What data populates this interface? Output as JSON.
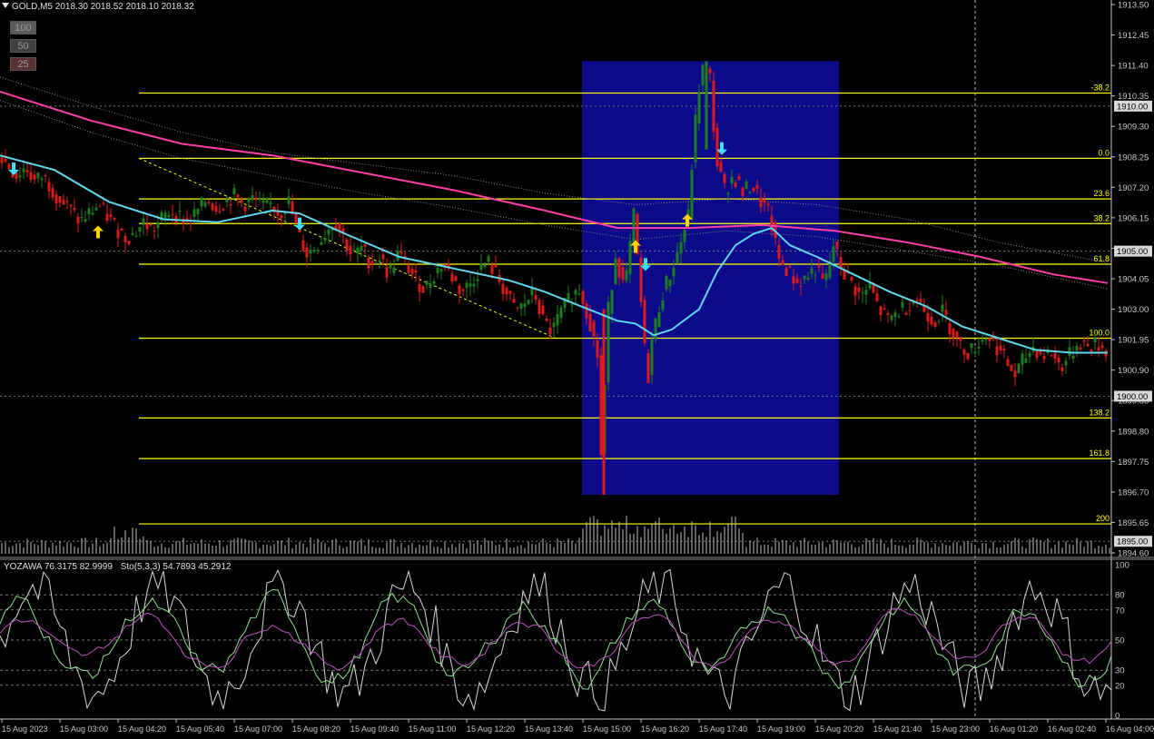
{
  "header": {
    "title": "GOLD,M5  2018.30 2018.52 2018.10 2018.32"
  },
  "buttons": [
    {
      "label": "100",
      "bg": "#5a5a5a"
    },
    {
      "label": "50",
      "bg": "#404040"
    },
    {
      "label": "25",
      "bg": "#5a3030"
    }
  ],
  "indicator_header": {
    "yozawa": "YOZAWA 76.3175 82.9999",
    "sto": "Sto(5,3,3) 54.7893 45.2912"
  },
  "colors": {
    "background": "#000000",
    "axis_text": "#c8c8c8",
    "grid": "#6e6e6e",
    "bull": "#1f7d1f",
    "bear": "#dd1a1a",
    "fib": "#ffff00",
    "ma_fast": "#5fd7f0",
    "ma_slow": "#ff3fa5",
    "highlight_box": "#0a0a8a",
    "volume": "#bfbfbf",
    "arrow_up": "#ffd400",
    "arrow_down": "#3fe0ff",
    "osc_white": "#d8d8d8",
    "osc_green": "#8fe08f",
    "osc_magenta": "#c050c0"
  },
  "chart_data": [
    {
      "type": "candlestick",
      "symbol": "GOLD",
      "timeframe": "M5",
      "price_axis": {
        "ylim": [
          1894.6,
          1913.5
        ],
        "ticks": [
          "1913.50",
          "1912.45",
          "1911.40",
          "1910.35",
          "1909.30",
          "1908.25",
          "1907.20",
          "1906.15",
          "1905.10",
          "1904.05",
          "1903.00",
          "1901.95",
          "1900.90",
          "1899.85",
          "1898.80",
          "1897.75",
          "1896.70",
          "1895.65",
          "1894.60"
        ],
        "markers": [
          {
            "label": "1910.00",
            "value": 1910.0
          },
          {
            "label": "1905.00",
            "value": 1905.0
          },
          {
            "label": "1900.00",
            "value": 1900.0
          },
          {
            "label": "1895.00",
            "value": 1895.0
          }
        ]
      },
      "time_axis": {
        "labels": [
          "15 Aug 2023",
          "15 Aug 03:00",
          "15 Aug 04:20",
          "15 Aug 05:40",
          "15 Aug 07:00",
          "15 Aug 08:20",
          "15 Aug 09:40",
          "15 Aug 11:00",
          "15 Aug 12:20",
          "15 Aug 13:40",
          "15 Aug 15:00",
          "15 Aug 16:20",
          "15 Aug 17:40",
          "15 Aug 19:00",
          "15 Aug 20:20",
          "15 Aug 21:40",
          "15 Aug 23:00",
          "16 Aug 01:20",
          "16 Aug 02:40",
          "16 Aug 04:00"
        ]
      },
      "fib_levels": [
        {
          "label": "-38.2",
          "price": 1910.45
        },
        {
          "label": "0.0",
          "price": 1908.2
        },
        {
          "label": "23.6",
          "price": 1906.8
        },
        {
          "label": "38.2",
          "price": 1905.95
        },
        {
          "label": "61.8",
          "price": 1904.55
        },
        {
          "label": "100.0",
          "price": 1902.0
        },
        {
          "label": "138.2",
          "price": 1899.25
        },
        {
          "label": "161.8",
          "price": 1897.85
        },
        {
          "label": "200",
          "price": 1895.6
        }
      ],
      "price_path": [
        [
          0,
          1908.3
        ],
        [
          10,
          1908.0
        ],
        [
          20,
          1907.6
        ],
        [
          30,
          1907.9
        ],
        [
          40,
          1907.4
        ],
        [
          50,
          1907.6
        ],
        [
          60,
          1907.1
        ],
        [
          70,
          1906.7
        ],
        [
          80,
          1906.4
        ],
        [
          90,
          1906.0
        ],
        [
          100,
          1906.3
        ],
        [
          110,
          1906.6
        ],
        [
          120,
          1906.2
        ],
        [
          130,
          1905.8
        ],
        [
          140,
          1905.5
        ],
        [
          150,
          1905.6
        ],
        [
          160,
          1906.0
        ],
        [
          170,
          1905.7
        ],
        [
          180,
          1906.1
        ],
        [
          190,
          1906.4
        ],
        [
          200,
          1906.2
        ],
        [
          210,
          1906.0
        ],
        [
          220,
          1906.4
        ],
        [
          230,
          1906.8
        ],
        [
          240,
          1906.5
        ],
        [
          250,
          1906.7
        ],
        [
          260,
          1906.9
        ],
        [
          270,
          1906.6
        ],
        [
          280,
          1906.8
        ],
        [
          290,
          1906.5
        ],
        [
          300,
          1906.6
        ],
        [
          310,
          1906.3
        ],
        [
          320,
          1906.7
        ],
        [
          330,
          1905.6
        ],
        [
          340,
          1904.9
        ],
        [
          350,
          1905.2
        ],
        [
          360,
          1905.6
        ],
        [
          370,
          1906.1
        ],
        [
          380,
          1905.5
        ],
        [
          390,
          1904.8
        ],
        [
          400,
          1905.1
        ],
        [
          410,
          1904.6
        ],
        [
          420,
          1904.8
        ],
        [
          430,
          1904.2
        ],
        [
          440,
          1904.9
        ],
        [
          450,
          1904.5
        ],
        [
          460,
          1904.0
        ],
        [
          470,
          1903.7
        ],
        [
          480,
          1904.2
        ],
        [
          490,
          1904.6
        ],
        [
          500,
          1904.1
        ],
        [
          510,
          1903.6
        ],
        [
          520,
          1903.9
        ],
        [
          530,
          1904.4
        ],
        [
          540,
          1904.6
        ],
        [
          550,
          1904.1
        ],
        [
          560,
          1903.5
        ],
        [
          570,
          1902.9
        ],
        [
          580,
          1903.2
        ],
        [
          590,
          1903.6
        ],
        [
          600,
          1902.6
        ],
        [
          610,
          1902.2
        ],
        [
          620,
          1902.9
        ],
        [
          630,
          1903.4
        ],
        [
          640,
          1903.7
        ],
        [
          650,
          1902.8
        ],
        [
          660,
          1901.4
        ],
        [
          665,
          1897.1
        ],
        [
          670,
          1902.5
        ],
        [
          680,
          1904.9
        ],
        [
          690,
          1903.6
        ],
        [
          700,
          1906.2
        ],
        [
          705,
          1904.4
        ],
        [
          715,
          1900.4
        ],
        [
          720,
          1901.9
        ],
        [
          730,
          1903.4
        ],
        [
          740,
          1904.2
        ],
        [
          750,
          1905.1
        ],
        [
          760,
          1906.2
        ],
        [
          765,
          1908.4
        ],
        [
          770,
          1910.2
        ],
        [
          775,
          1911.3
        ],
        [
          780,
          1911.2
        ],
        [
          785,
          1910.9
        ],
        [
          790,
          1908.2
        ],
        [
          800,
          1907.1
        ],
        [
          810,
          1907.6
        ],
        [
          820,
          1907.0
        ],
        [
          830,
          1907.3
        ],
        [
          840,
          1906.7
        ],
        [
          850,
          1906.2
        ],
        [
          855,
          1905.3
        ],
        [
          860,
          1904.7
        ],
        [
          870,
          1904.3
        ],
        [
          880,
          1903.9
        ],
        [
          890,
          1904.1
        ],
        [
          900,
          1904.4
        ],
        [
          910,
          1903.8
        ],
        [
          920,
          1905.2
        ],
        [
          930,
          1904.3
        ],
        [
          940,
          1903.9
        ],
        [
          950,
          1903.4
        ],
        [
          960,
          1903.8
        ],
        [
          970,
          1903.0
        ],
        [
          980,
          1902.6
        ],
        [
          990,
          1902.9
        ],
        [
          1000,
          1903.1
        ],
        [
          1010,
          1903.4
        ],
        [
          1020,
          1903.0
        ],
        [
          1030,
          1902.6
        ],
        [
          1040,
          1902.9
        ],
        [
          1050,
          1902.3
        ],
        [
          1060,
          1901.7
        ],
        [
          1070,
          1901.5
        ],
        [
          1080,
          1901.9
        ],
        [
          1090,
          1902.1
        ],
        [
          1100,
          1901.7
        ],
        [
          1110,
          1901.2
        ],
        [
          1120,
          1900.7
        ],
        [
          1130,
          1901.3
        ],
        [
          1140,
          1901.7
        ],
        [
          1150,
          1901.4
        ],
        [
          1160,
          1901.5
        ],
        [
          1170,
          1901.0
        ],
        [
          1180,
          1901.4
        ],
        [
          1190,
          1901.9
        ],
        [
          1200,
          1901.7
        ],
        [
          1210,
          1901.8
        ],
        [
          1220,
          1901.6
        ]
      ],
      "ma_fast": [
        [
          0,
          1908.3
        ],
        [
          60,
          1907.8
        ],
        [
          120,
          1906.7
        ],
        [
          180,
          1906.1
        ],
        [
          240,
          1906.0
        ],
        [
          300,
          1906.4
        ],
        [
          330,
          1906.3
        ],
        [
          380,
          1905.6
        ],
        [
          440,
          1904.8
        ],
        [
          500,
          1904.4
        ],
        [
          560,
          1904.0
        ],
        [
          600,
          1903.6
        ],
        [
          640,
          1903.1
        ],
        [
          680,
          1902.6
        ],
        [
          700,
          1902.5
        ],
        [
          720,
          1902.1
        ],
        [
          740,
          1902.3
        ],
        [
          770,
          1903.0
        ],
        [
          790,
          1904.3
        ],
        [
          810,
          1905.2
        ],
        [
          830,
          1905.6
        ],
        [
          850,
          1905.8
        ],
        [
          870,
          1905.2
        ],
        [
          900,
          1904.8
        ],
        [
          940,
          1904.2
        ],
        [
          980,
          1903.6
        ],
        [
          1020,
          1903.1
        ],
        [
          1060,
          1902.4
        ],
        [
          1100,
          1902.0
        ],
        [
          1140,
          1901.6
        ],
        [
          1180,
          1901.5
        ],
        [
          1220,
          1901.5
        ]
      ],
      "ma_slow": [
        [
          0,
          1910.5
        ],
        [
          100,
          1909.5
        ],
        [
          200,
          1908.7
        ],
        [
          300,
          1908.3
        ],
        [
          400,
          1907.7
        ],
        [
          500,
          1907.1
        ],
        [
          600,
          1906.4
        ],
        [
          680,
          1905.8
        ],
        [
          760,
          1905.8
        ],
        [
          840,
          1905.9
        ],
        [
          920,
          1905.7
        ],
        [
          1000,
          1905.3
        ],
        [
          1080,
          1904.8
        ],
        [
          1160,
          1904.2
        ],
        [
          1220,
          1903.9
        ]
      ],
      "ma_dotted_upper": [
        [
          0,
          1911.0
        ],
        [
          100,
          1910.0
        ],
        [
          200,
          1909.1
        ],
        [
          300,
          1908.4
        ],
        [
          400,
          1908.0
        ],
        [
          500,
          1907.6
        ],
        [
          600,
          1907.0
        ],
        [
          700,
          1906.6
        ],
        [
          800,
          1906.8
        ],
        [
          900,
          1906.6
        ],
        [
          1000,
          1906.1
        ],
        [
          1100,
          1905.3
        ],
        [
          1220,
          1904.6
        ]
      ],
      "ma_dotted_lower": [
        [
          0,
          1910.2
        ],
        [
          100,
          1909.1
        ],
        [
          200,
          1908.2
        ],
        [
          300,
          1907.6
        ],
        [
          400,
          1907.0
        ],
        [
          500,
          1906.5
        ],
        [
          600,
          1905.9
        ],
        [
          700,
          1905.4
        ],
        [
          800,
          1905.7
        ],
        [
          900,
          1905.5
        ],
        [
          1000,
          1905.0
        ],
        [
          1100,
          1904.5
        ],
        [
          1220,
          1903.7
        ]
      ],
      "arrows": [
        {
          "dir": "down",
          "x": 15,
          "price": 1907.9
        },
        {
          "dir": "up",
          "x": 108,
          "price": 1905.6
        },
        {
          "dir": "down",
          "x": 330,
          "price": 1906.0
        },
        {
          "dir": "up",
          "x": 700,
          "price": 1905.1
        },
        {
          "dir": "down",
          "x": 711,
          "price": 1904.6
        },
        {
          "dir": "up",
          "x": 757,
          "price": 1906.0
        },
        {
          "dir": "down",
          "x": 795,
          "price": 1908.6
        }
      ],
      "highlight_zone": {
        "x_start": 641,
        "x_end": 924,
        "price_top": 1911.55,
        "price_bottom": 1896.6
      }
    },
    {
      "type": "line",
      "name": "YOZAWA / Sto(5,3,3)",
      "ylim": [
        0,
        100
      ],
      "levels": [
        100,
        80,
        70,
        50,
        30,
        20,
        0
      ]
    }
  ]
}
